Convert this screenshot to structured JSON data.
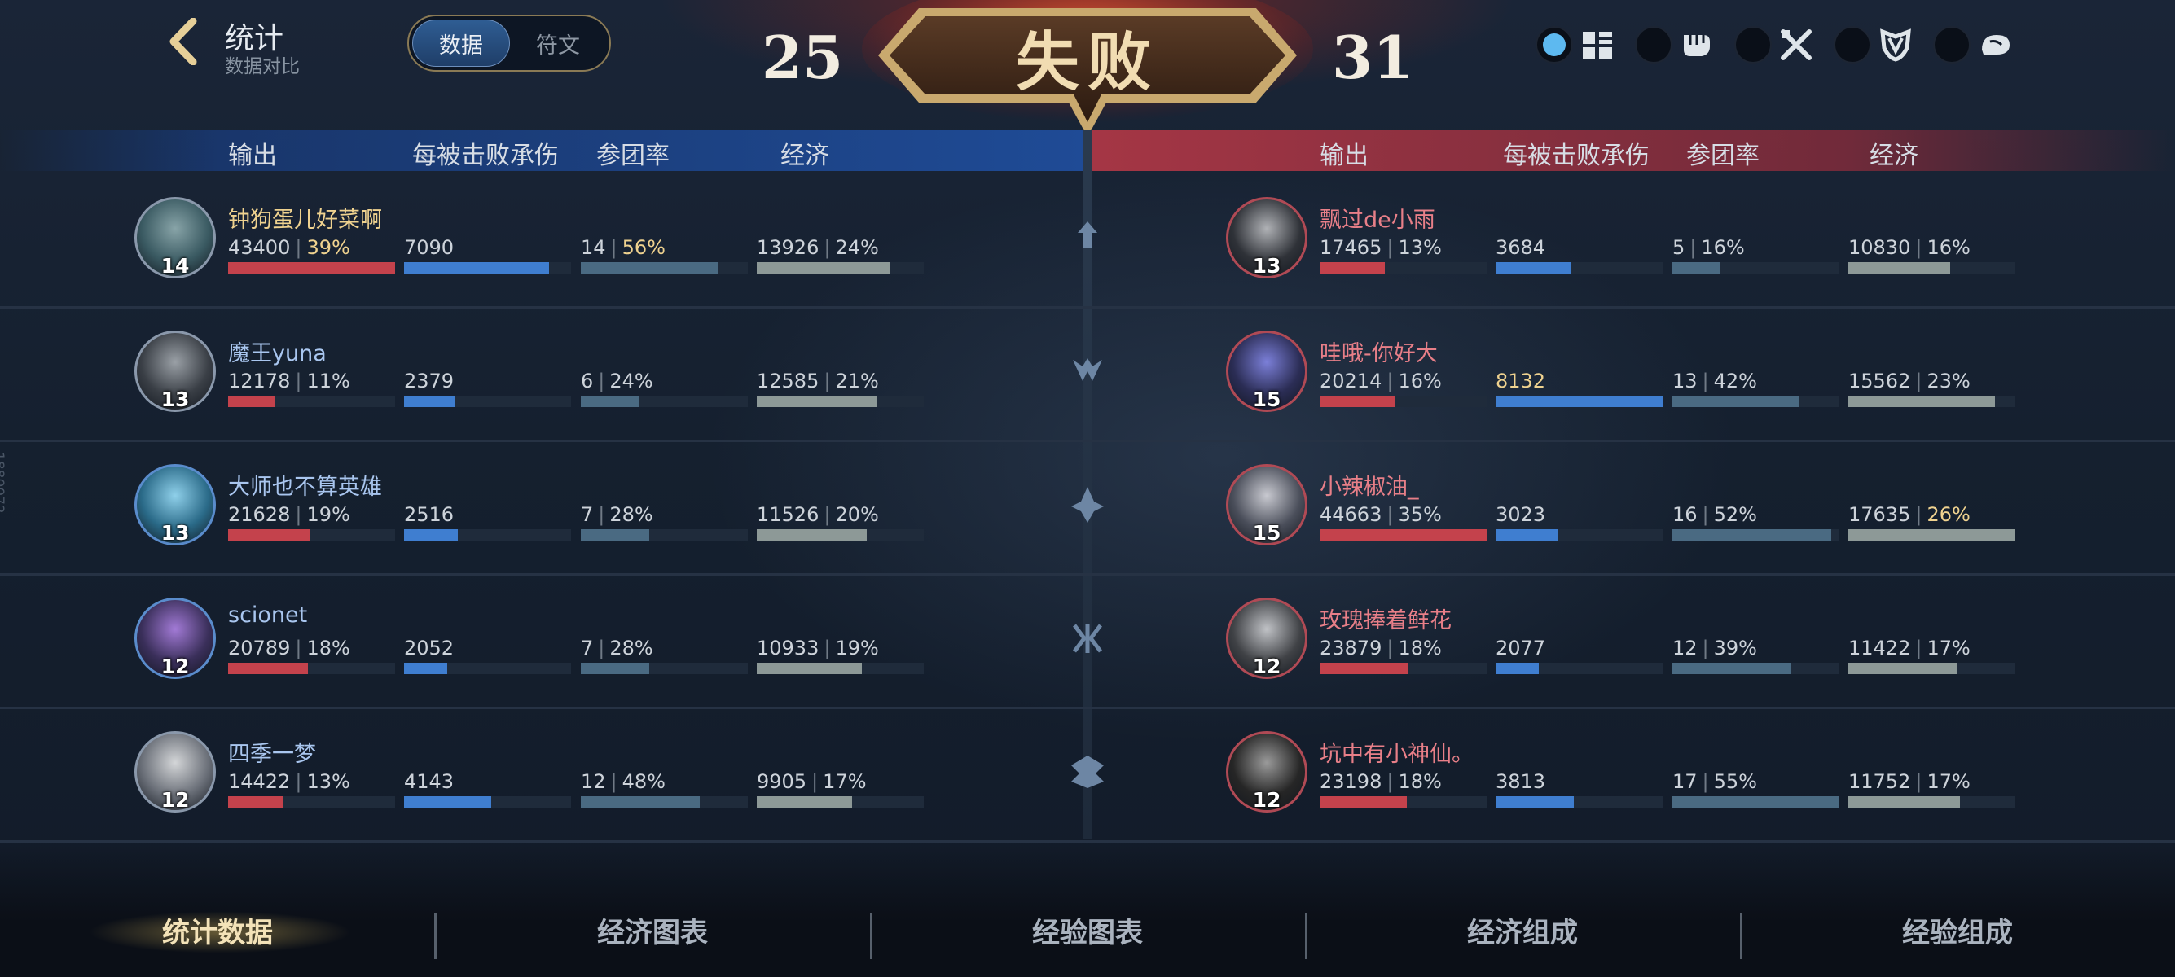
{
  "header": {
    "title": "统计",
    "subtitle": "数据对比",
    "toggle": [
      "数据",
      "符文"
    ],
    "toggle_active": 0
  },
  "scoreboard": {
    "left_score": "25",
    "right_score": "31",
    "result": "失败"
  },
  "filters": [
    {
      "icon": "grid-icon",
      "selected": true
    },
    {
      "icon": "fist-icon",
      "selected": false
    },
    {
      "icon": "crossed-swords-icon",
      "selected": false
    },
    {
      "icon": "shield-icon",
      "selected": false
    },
    {
      "icon": "conch-icon",
      "selected": false
    }
  ],
  "columns": [
    "输出",
    "每被击败承伤",
    "参团率",
    "经济"
  ],
  "left_team": [
    {
      "name": "钟狗蛋儿好菜啊",
      "name_color": "gold",
      "level": "14",
      "dmg": "43400",
      "dmg_pct": "39%",
      "dmg_hl": true,
      "dmg_bar": 1.0,
      "tank": "7090",
      "tank_bar": 0.87,
      "kp": "14",
      "kp_pct": "56%",
      "kp_hl": true,
      "kp_bar": 0.82,
      "gold": "13926",
      "gold_pct": "24%",
      "gold_hl": false,
      "gold_bar": 0.8
    },
    {
      "name": "魔王yuna",
      "name_color": "blue",
      "level": "13",
      "dmg": "12178",
      "dmg_pct": "11%",
      "dmg_hl": false,
      "dmg_bar": 0.28,
      "tank": "2379",
      "tank_bar": 0.3,
      "kp": "6",
      "kp_pct": "24%",
      "kp_hl": false,
      "kp_bar": 0.35,
      "gold": "12585",
      "gold_pct": "21%",
      "gold_hl": false,
      "gold_bar": 0.72
    },
    {
      "name": "大师也不算英雄",
      "name_color": "blue",
      "level": "13",
      "dmg": "21628",
      "dmg_pct": "19%",
      "dmg_hl": false,
      "dmg_bar": 0.49,
      "tank": "2516",
      "tank_bar": 0.32,
      "kp": "7",
      "kp_pct": "28%",
      "kp_hl": false,
      "kp_bar": 0.41,
      "gold": "11526",
      "gold_pct": "20%",
      "gold_hl": false,
      "gold_bar": 0.66
    },
    {
      "name": "scionet",
      "name_color": "blue",
      "level": "12",
      "dmg": "20789",
      "dmg_pct": "18%",
      "dmg_hl": false,
      "dmg_bar": 0.48,
      "tank": "2052",
      "tank_bar": 0.26,
      "kp": "7",
      "kp_pct": "28%",
      "kp_hl": false,
      "kp_bar": 0.41,
      "gold": "10933",
      "gold_pct": "19%",
      "gold_hl": false,
      "gold_bar": 0.63
    },
    {
      "name": "四季一梦",
      "name_color": "blue",
      "level": "12",
      "dmg": "14422",
      "dmg_pct": "13%",
      "dmg_hl": false,
      "dmg_bar": 0.33,
      "tank": "4143",
      "tank_bar": 0.52,
      "kp": "12",
      "kp_pct": "48%",
      "kp_hl": false,
      "kp_bar": 0.71,
      "gold": "9905",
      "gold_pct": "17%",
      "gold_hl": false,
      "gold_bar": 0.57
    }
  ],
  "right_team": [
    {
      "name": "飘过de小雨",
      "name_color": "red",
      "level": "13",
      "dmg": "17465",
      "dmg_pct": "13%",
      "dmg_hl": false,
      "dmg_bar": 0.39,
      "tank": "3684",
      "tank_bar": 0.45,
      "kp": "5",
      "kp_pct": "16%",
      "kp_hl": false,
      "kp_bar": 0.29,
      "gold": "10830",
      "gold_pct": "16%",
      "gold_hl": false,
      "gold_bar": 0.61
    },
    {
      "name": "哇哦-你好大",
      "name_color": "red",
      "level": "15",
      "dmg": "20214",
      "dmg_pct": "16%",
      "dmg_hl": false,
      "dmg_bar": 0.45,
      "tank": "8132",
      "tank_hl": true,
      "tank_bar": 1.0,
      "kp": "13",
      "kp_pct": "42%",
      "kp_hl": false,
      "kp_bar": 0.76,
      "gold": "15562",
      "gold_pct": "23%",
      "gold_hl": false,
      "gold_bar": 0.88
    },
    {
      "name": "小辣椒油_",
      "name_color": "red",
      "level": "15",
      "dmg": "44663",
      "dmg_pct": "35%",
      "dmg_hl": false,
      "dmg_bar": 1.0,
      "tank": "3023",
      "tank_bar": 0.37,
      "kp": "16",
      "kp_pct": "52%",
      "kp_hl": false,
      "kp_bar": 0.95,
      "gold": "17635",
      "gold_pct": "26%",
      "gold_hl": true,
      "gold_bar": 1.0
    },
    {
      "name": "玫瑰捧着鲜花",
      "name_color": "red",
      "level": "12",
      "dmg": "23879",
      "dmg_pct": "18%",
      "dmg_hl": false,
      "dmg_bar": 0.53,
      "tank": "2077",
      "tank_bar": 0.26,
      "kp": "12",
      "kp_pct": "39%",
      "kp_hl": false,
      "kp_bar": 0.71,
      "gold": "11422",
      "gold_pct": "17%",
      "gold_hl": false,
      "gold_bar": 0.65
    },
    {
      "name": "坑中有小神仙。",
      "name_color": "red",
      "level": "12",
      "dmg": "23198",
      "dmg_pct": "18%",
      "dmg_hl": false,
      "dmg_bar": 0.52,
      "tank": "3813",
      "tank_bar": 0.47,
      "kp": "17",
      "kp_pct": "55%",
      "kp_hl": false,
      "kp_bar": 1.0,
      "gold": "11752",
      "gold_pct": "17%",
      "gold_hl": false,
      "gold_bar": 0.67
    }
  ],
  "tabs": [
    "统计数据",
    "经济图表",
    "经验图表",
    "经济组成",
    "经验组成"
  ],
  "active_tab": 0,
  "side_text": "1880072",
  "colors": {
    "damage": "#c4424c",
    "tank": "#3f7ed0",
    "participation": "#4a6a82",
    "economy": "#8d9997",
    "highlight": "#efd28f"
  }
}
